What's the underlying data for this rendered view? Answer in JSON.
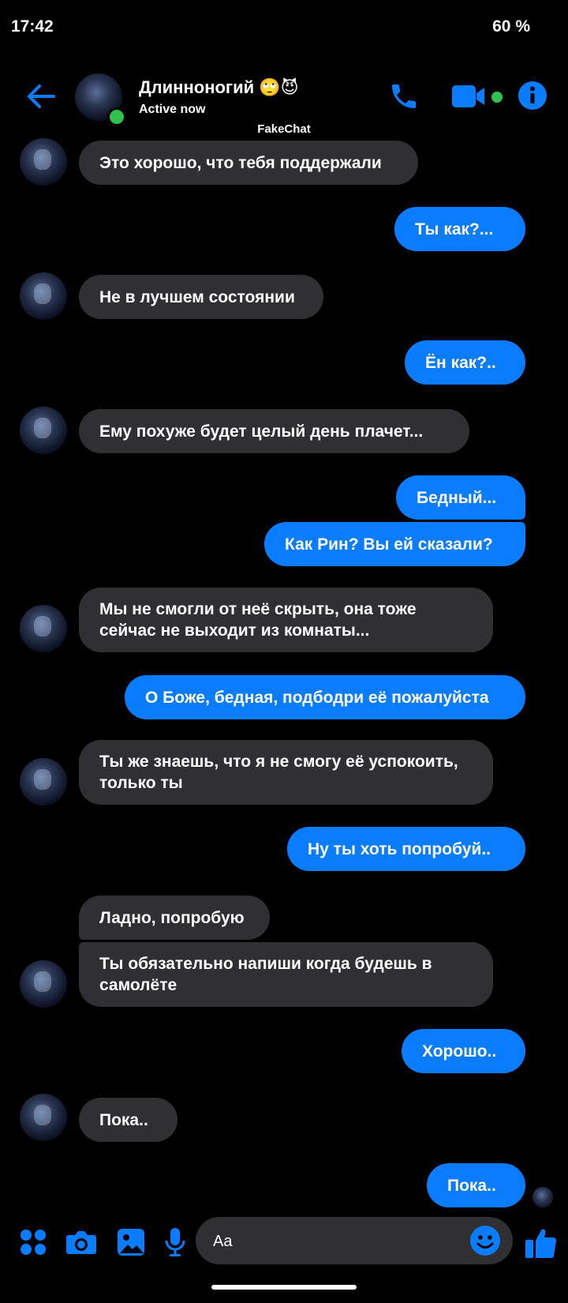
{
  "status_bar": {
    "time": "17:42",
    "battery": "60 %"
  },
  "header": {
    "contact_name": "Длинноногий 🙄😈",
    "status": "Active now",
    "watermark": "FakeChat",
    "icons": [
      "back-arrow-icon",
      "phone-icon",
      "video-icon",
      "info-icon"
    ]
  },
  "messages": [
    {
      "side": "in",
      "text": "Это хорошо, что тебя поддержали"
    },
    {
      "side": "out",
      "text": "Ты как?..."
    },
    {
      "side": "in",
      "text": "Не в лучшем состоянии"
    },
    {
      "side": "out",
      "text": "Ён как?.."
    },
    {
      "side": "in",
      "text": "Ему похуже будет целый день плачет..."
    },
    {
      "side": "out",
      "text": "Бедный..."
    },
    {
      "side": "out",
      "text": "Как Рин? Вы ей сказали?"
    },
    {
      "side": "in",
      "text": "Мы не смогли от неё скрыть, она тоже сейчас не выходит из комнаты..."
    },
    {
      "side": "out",
      "text": "О Боже, бедная, подбодри её пожалуйста"
    },
    {
      "side": "in",
      "text": "Ты же знаешь, что я не смогу её успокоить, только ты"
    },
    {
      "side": "out",
      "text": "Ну ты хоть попробуй.."
    },
    {
      "side": "in",
      "text": "Ладно, попробую"
    },
    {
      "side": "in",
      "text": "Ты обязательно напиши когда будешь в самолёте"
    },
    {
      "side": "out",
      "text": "Хорошо.."
    },
    {
      "side": "in",
      "text": "Пока.."
    },
    {
      "side": "out",
      "text": "Пока.."
    }
  ],
  "composer": {
    "placeholder": "Aa",
    "icons": [
      "apps-icon",
      "camera-icon",
      "gallery-icon",
      "mic-icon",
      "emoji-icon",
      "thumbs-up-icon"
    ]
  },
  "colors": {
    "accent": "#0a7cff",
    "incoming_bubble": "#303033",
    "background": "#000000",
    "online": "#31c24d"
  }
}
